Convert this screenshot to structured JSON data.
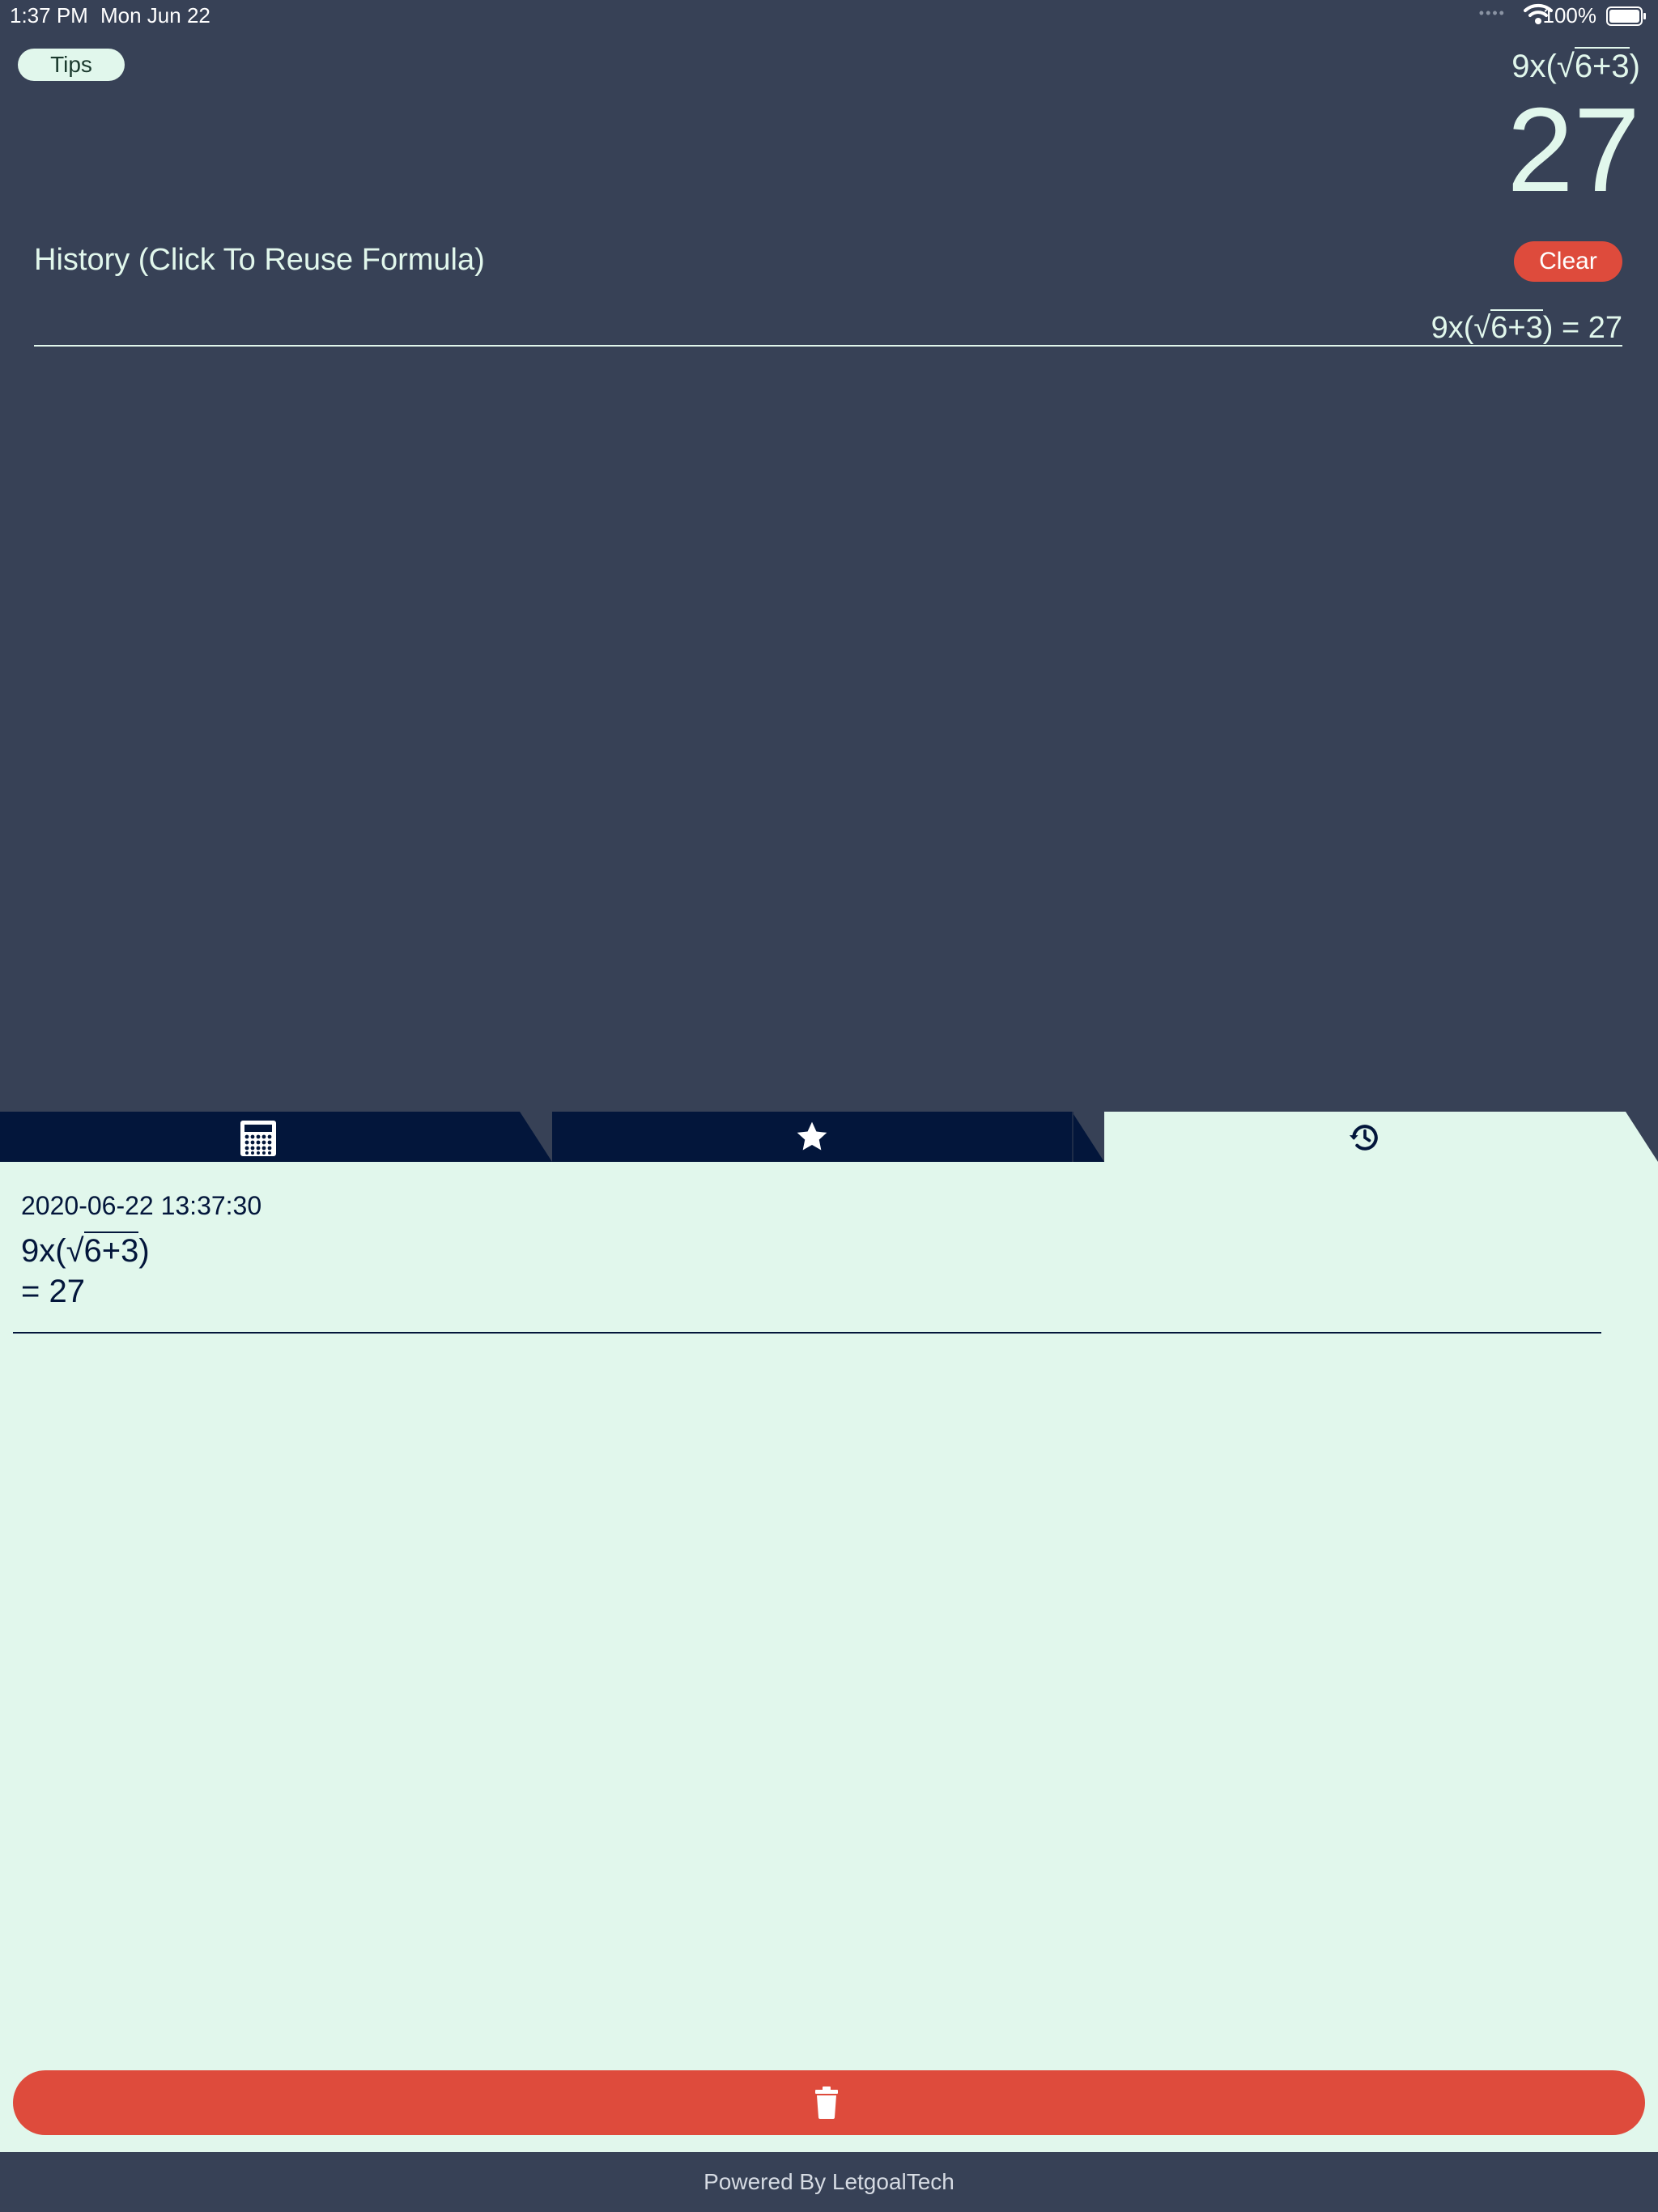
{
  "status_bar": {
    "time": "1:37 PM",
    "date": "Mon Jun 22",
    "battery": "100%",
    "icons": [
      "cellular-dots-icon",
      "wifi-icon",
      "battery-icon"
    ]
  },
  "header": {
    "tips_label": "Tips",
    "formula_prefix": "9x(√",
    "formula_radicand": "6+3",
    "formula_suffix": ")",
    "result": "27"
  },
  "history_section": {
    "title": "History (Click To Reuse Formula)",
    "clear_label": "Clear",
    "item": {
      "prefix": "9x(√",
      "radicand": "6+3",
      "suffix": ") = 27"
    }
  },
  "tabs": [
    {
      "name": "calculator",
      "icon": "calculator-icon",
      "active": false
    },
    {
      "name": "favorites",
      "icon": "star-icon",
      "active": false
    },
    {
      "name": "history",
      "icon": "history-icon",
      "active": true
    }
  ],
  "history_panel": {
    "entries": [
      {
        "timestamp": "2020-06-22 13:37:30",
        "formula_prefix": "9x(√",
        "formula_radicand": "6+3",
        "formula_suffix": ")",
        "result": "= 27"
      }
    ],
    "delete_icon": "trash-icon"
  },
  "footer": {
    "text": "Powered By LetgoalTech"
  },
  "colors": {
    "background": "#374156",
    "panel": "#e1f7ec",
    "tab_inactive": "#03163b",
    "danger": "#de4b3c",
    "text_light": "#e1f7ec",
    "text_dark": "#03163b"
  }
}
